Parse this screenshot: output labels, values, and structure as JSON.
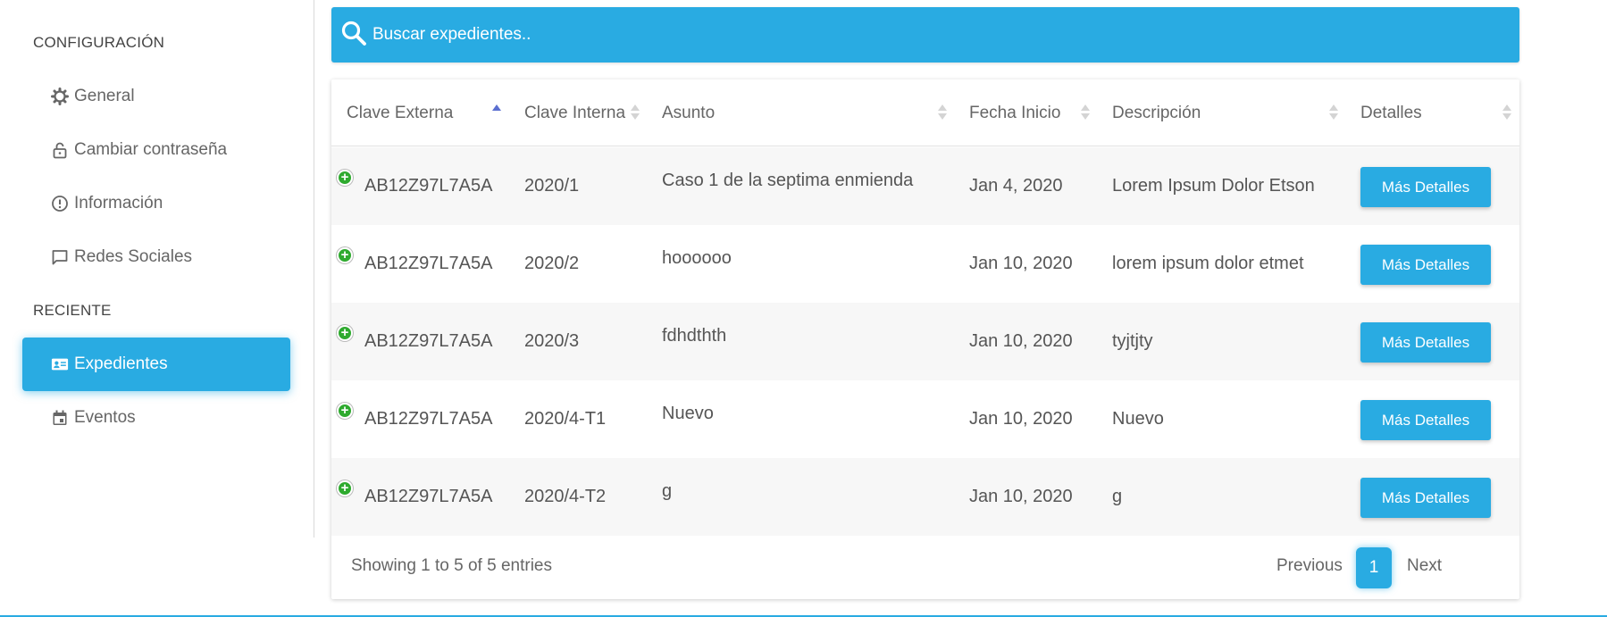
{
  "sidebar": {
    "section_config": "CONFIGURACIÓN",
    "section_recent": "RECIENTE",
    "items": [
      {
        "label": "General",
        "icon": "gear-icon"
      },
      {
        "label": "Cambiar contraseña",
        "icon": "lock-icon"
      },
      {
        "label": "Información",
        "icon": "info-icon"
      },
      {
        "label": "Redes Sociales",
        "icon": "chat-icon"
      },
      {
        "label": "Expedientes",
        "icon": "id-card-icon",
        "active": true
      },
      {
        "label": "Eventos",
        "icon": "calendar-icon"
      }
    ]
  },
  "search": {
    "placeholder": "Buscar expedientes.."
  },
  "table": {
    "columns": [
      "Clave Externa",
      "Clave Interna",
      "Asunto",
      "Fecha Inicio",
      "Descripción",
      "Detalles"
    ],
    "sorted_column": "Clave Externa",
    "rows": [
      {
        "clave_externa": "AB12Z97L7A5A",
        "clave_interna": "2020/1",
        "asunto": "Caso 1 de la septima enmienda",
        "fecha": "Jan 4, 2020",
        "descripcion": "Lorem Ipsum Dolor Etson",
        "detalles": "Más Detalles"
      },
      {
        "clave_externa": "AB12Z97L7A5A",
        "clave_interna": "2020/2",
        "asunto": "hoooooo",
        "fecha": "Jan 10, 2020",
        "descripcion": "lorem ipsum dolor etmet",
        "detalles": "Más Detalles"
      },
      {
        "clave_externa": "AB12Z97L7A5A",
        "clave_interna": "2020/3",
        "asunto": "fdhdthth",
        "fecha": "Jan 10, 2020",
        "descripcion": "tyjtjty",
        "detalles": "Más Detalles"
      },
      {
        "clave_externa": "AB12Z97L7A5A",
        "clave_interna": "2020/4-T1",
        "asunto": "Nuevo",
        "fecha": "Jan 10, 2020",
        "descripcion": "Nuevo",
        "detalles": "Más Detalles"
      },
      {
        "clave_externa": "AB12Z97L7A5A",
        "clave_interna": "2020/4-T2",
        "asunto": "g",
        "fecha": "Jan 10, 2020",
        "descripcion": "g",
        "detalles": "Más Detalles"
      }
    ]
  },
  "footer": {
    "info": "Showing 1 to 5 of 5 entries",
    "previous": "Previous",
    "page": "1",
    "next": "Next"
  },
  "colors": {
    "accent": "#29abe2",
    "expand": "#2eaa2e",
    "sort_active": "#5b6fd0"
  }
}
